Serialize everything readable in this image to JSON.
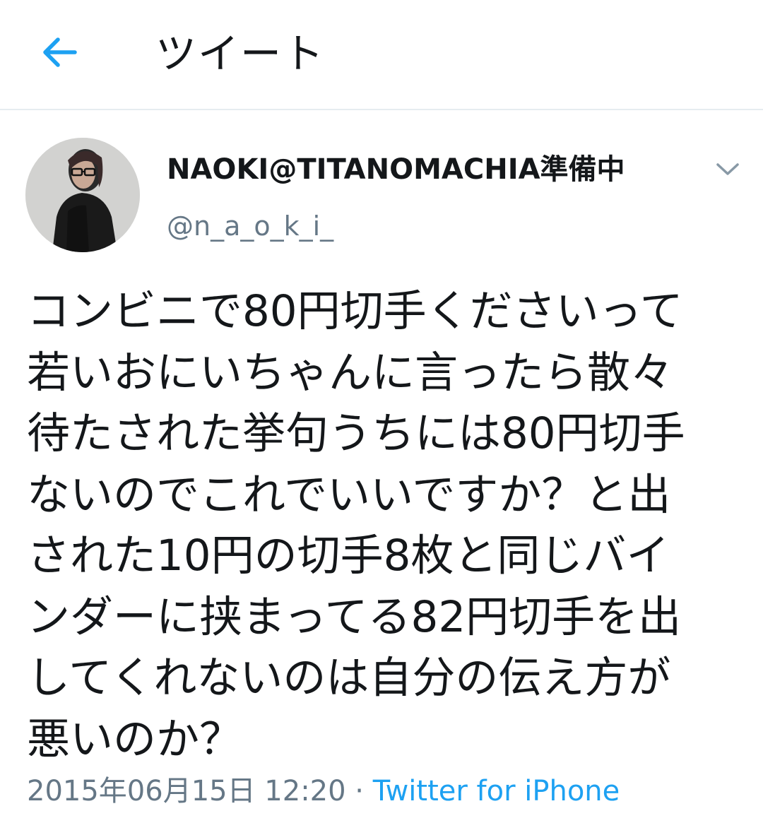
{
  "header": {
    "title": "ツイート",
    "back_icon": "arrow-left-icon",
    "accent_color": "#1da1f2"
  },
  "tweet": {
    "display_name": "NAOKI@TITANOMACHIA準備中",
    "handle": "@n_a_o_k_i_",
    "menu_icon": "chevron-down-icon",
    "text_lines": [
      "コンビニで80円切手くださいって",
      "若いおにいちゃんに言ったら散々",
      "待たされた挙句うちには80円切手",
      "ないのでこれでいいですか？と出",
      "された10円の切手8枚と同じバイ",
      "ンダーに挟まってる82円切手を出",
      "してくれないのは自分の伝え方が",
      "悪いのか？"
    ],
    "timestamp": "2015年06月15日 12:20",
    "separator": " · ",
    "source": "Twitter for iPhone"
  },
  "colors": {
    "text": "#14171a",
    "secondary_text": "#657786",
    "link": "#1da1f2",
    "divider": "#e6ecf0"
  }
}
